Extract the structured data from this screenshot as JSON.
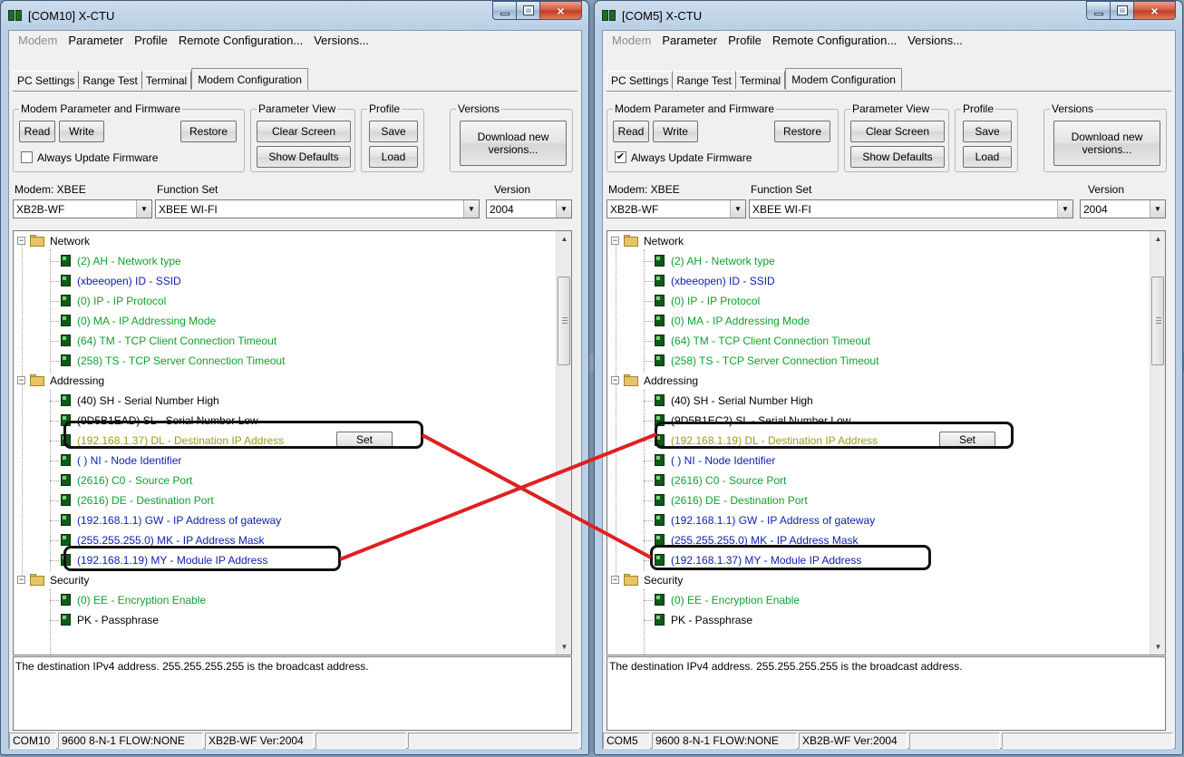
{
  "windows": [
    {
      "title": "[COM10] X-CTU",
      "menu": [
        "Modem",
        "Parameter",
        "Profile",
        "Remote Configuration...",
        "Versions..."
      ],
      "tabs": [
        "PC Settings",
        "Range Test",
        "Terminal",
        "Modem Configuration"
      ],
      "active_tab": "Modem Configuration",
      "groups": {
        "firmware": {
          "label": "Modem Parameter and Firmware",
          "read": "Read",
          "write": "Write",
          "restore": "Restore",
          "checkbox_label": "Always Update Firmware",
          "checkbox_checked": false,
          "checkbox_mark": ""
        },
        "view": {
          "label": "Parameter View",
          "clear": "Clear Screen",
          "defaults": "Show Defaults"
        },
        "profile": {
          "label": "Profile",
          "save": "Save",
          "load": "Load"
        },
        "versions": {
          "label": "Versions",
          "download": "Download new versions..."
        }
      },
      "modem_label": "Modem: XBEE",
      "modem_value": "XB2B-WF",
      "function_label": "Function Set",
      "function_value": "XBEE WI-FI",
      "version_label": "Version",
      "version_value": "2004",
      "tree": {
        "network": "Network",
        "network_items": [
          {
            "text": "(2) AH - Network type",
            "color": "green"
          },
          {
            "text": "(xbeeopen) ID - SSID",
            "color": "blue"
          },
          {
            "text": "(0) IP - IP Protocol",
            "color": "green"
          },
          {
            "text": "(0) MA - IP Addressing Mode",
            "color": "green"
          },
          {
            "text": "(64) TM - TCP Client Connection Timeout",
            "color": "green"
          },
          {
            "text": "(258) TS - TCP Server Connection Timeout",
            "color": "green"
          }
        ],
        "addressing": "Addressing",
        "addressing_items": [
          {
            "text": "(40) SH - Serial Number High",
            "color": "black"
          },
          {
            "text": "(9D5B1EAD) SL - Serial Number Low",
            "color": "black"
          },
          {
            "text": "(192.168.1.37) DL - Destination IP Address",
            "color": "gold"
          },
          {
            "text": "( ) NI - Node Identifier",
            "color": "blue"
          },
          {
            "text": "(2616) C0 - Source Port",
            "color": "green"
          },
          {
            "text": "(2616) DE - Destination Port",
            "color": "green"
          },
          {
            "text": "(192.168.1.1) GW - IP Address of gateway",
            "color": "blue"
          },
          {
            "text": "(255.255.255.0) MK - IP Address Mask",
            "color": "blue"
          },
          {
            "text": "(192.168.1.19) MY - Module IP Address",
            "color": "blue"
          }
        ],
        "security": "Security",
        "security_items": [
          {
            "text": "(0) EE - Encryption Enable",
            "color": "green"
          },
          {
            "text": "PK - Passphrase",
            "color": "black"
          }
        ],
        "set_label": "Set"
      },
      "description": "The destination IPv4 address. 255.255.255.255 is the broadcast address.",
      "status": [
        "COM10",
        "9600 8-N-1  FLOW:NONE",
        "XB2B-WF  Ver:2004"
      ]
    },
    {
      "title": "[COM5] X-CTU",
      "menu": [
        "Modem",
        "Parameter",
        "Profile",
        "Remote Configuration...",
        "Versions..."
      ],
      "tabs": [
        "PC Settings",
        "Range Test",
        "Terminal",
        "Modem Configuration"
      ],
      "active_tab": "Modem Configuration",
      "groups": {
        "firmware": {
          "label": "Modem Parameter and Firmware",
          "read": "Read",
          "write": "Write",
          "restore": "Restore",
          "checkbox_label": "Always Update Firmware",
          "checkbox_checked": true,
          "checkbox_mark": "✔"
        },
        "view": {
          "label": "Parameter View",
          "clear": "Clear Screen",
          "defaults": "Show Defaults"
        },
        "profile": {
          "label": "Profile",
          "save": "Save",
          "load": "Load"
        },
        "versions": {
          "label": "Versions",
          "download": "Download new versions..."
        }
      },
      "modem_label": "Modem: XBEE",
      "modem_value": "XB2B-WF",
      "function_label": "Function Set",
      "function_value": "XBEE WI-FI",
      "version_label": "Version",
      "version_value": "2004",
      "tree": {
        "network": "Network",
        "network_items": [
          {
            "text": "(2) AH - Network type",
            "color": "green"
          },
          {
            "text": "(xbeeopen) ID - SSID",
            "color": "blue"
          },
          {
            "text": "(0) IP - IP Protocol",
            "color": "green"
          },
          {
            "text": "(0) MA - IP Addressing Mode",
            "color": "green"
          },
          {
            "text": "(64) TM - TCP Client Connection Timeout",
            "color": "green"
          },
          {
            "text": "(258) TS - TCP Server Connection Timeout",
            "color": "green"
          }
        ],
        "addressing": "Addressing",
        "addressing_items": [
          {
            "text": "(40) SH - Serial Number High",
            "color": "black"
          },
          {
            "text": "(9D5B1EC2) SL - Serial Number Low",
            "color": "black"
          },
          {
            "text": "(192.168.1.19) DL - Destination IP Address",
            "color": "gold"
          },
          {
            "text": "( ) NI - Node Identifier",
            "color": "blue"
          },
          {
            "text": "(2616) C0 - Source Port",
            "color": "green"
          },
          {
            "text": "(2616) DE - Destination Port",
            "color": "green"
          },
          {
            "text": "(192.168.1.1) GW - IP Address of gateway",
            "color": "blue"
          },
          {
            "text": "(255.255.255.0) MK - IP Address Mask",
            "color": "blue"
          },
          {
            "text": "(192.168.1.37) MY - Module IP Address",
            "color": "blue"
          }
        ],
        "security": "Security",
        "security_items": [
          {
            "text": "(0) EE - Encryption Enable",
            "color": "green"
          },
          {
            "text": "PK - Passphrase",
            "color": "black"
          }
        ],
        "set_label": "Set"
      },
      "description": "The destination IPv4 address. 255.255.255.255 is the broadcast address.",
      "status": [
        "COM5",
        "9600 8-N-1  FLOW:NONE",
        "XB2B-WF  Ver:2004"
      ]
    }
  ],
  "icons": {
    "minimize": "minimize-icon",
    "maximize": "maximize-icon",
    "close": "×",
    "dropdown": "▼",
    "scroll_up": "▲",
    "scroll_down": "▼",
    "expand": "−"
  },
  "colors": {
    "annotation_line": "#e02020",
    "highlight_border": "#111111",
    "green_text": "#10a030",
    "blue_text": "#1020b0",
    "gold_text": "#9b9b1f"
  }
}
